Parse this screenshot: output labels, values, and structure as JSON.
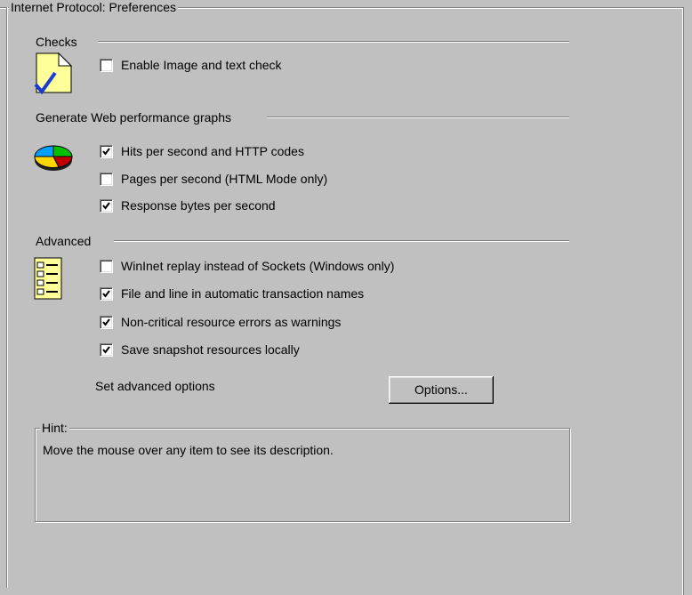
{
  "group_title": "Internet Protocol: Preferences",
  "checks": {
    "header": "Checks",
    "icon": "checklist-document-icon",
    "items": [
      {
        "label": "Enable Image and text check",
        "checked": false
      }
    ]
  },
  "graphs": {
    "header": "Generate Web performance graphs",
    "icon": "pie-chart-icon",
    "items": [
      {
        "label": "Hits per second and HTTP codes",
        "checked": true
      },
      {
        "label": "Pages per second (HTML Mode only)",
        "checked": false
      },
      {
        "label": "Response bytes per second",
        "checked": true
      }
    ]
  },
  "advanced": {
    "header": "Advanced",
    "icon": "settings-list-icon",
    "items": [
      {
        "label": "WinInet replay instead of Sockets (Windows only)",
        "checked": false
      },
      {
        "label": "File and line in automatic transaction names",
        "checked": true
      },
      {
        "label": "Non-critical resource errors as warnings",
        "checked": true
      },
      {
        "label": "Save snapshot resources locally",
        "checked": true
      }
    ],
    "set_options_label": "Set advanced options",
    "options_button": "Options..."
  },
  "hint": {
    "title": "Hint:",
    "text": "Move the mouse over any item to see its description."
  },
  "colors": {
    "background": "#c0c0c0",
    "shadow": "#808080",
    "highlight": "#ffffff",
    "check_mark": "#000000",
    "icon_check": "#1a3bd6",
    "icon_doc": "#ffff99"
  }
}
